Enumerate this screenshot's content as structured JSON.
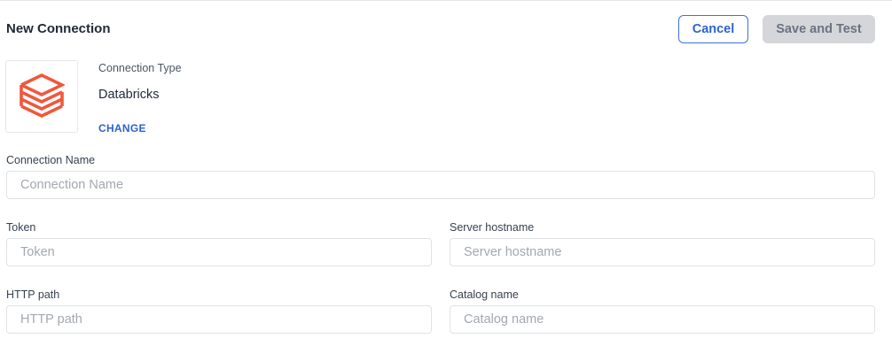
{
  "header": {
    "title": "New Connection",
    "cancel_label": "Cancel",
    "save_label": "Save and Test"
  },
  "connection_type": {
    "label": "Connection Type",
    "value": "Databricks",
    "change_label": "CHANGE",
    "icon": "databricks-logo",
    "icon_color": "#f0573d"
  },
  "fields": {
    "connection_name": {
      "label": "Connection Name",
      "placeholder": "Connection Name",
      "value": ""
    },
    "token": {
      "label": "Token",
      "placeholder": "Token",
      "value": ""
    },
    "server_hostname": {
      "label": "Server hostname",
      "placeholder": "Server hostname",
      "value": ""
    },
    "http_path": {
      "label": "HTTP path",
      "placeholder": "HTTP path",
      "value": ""
    },
    "catalog_name": {
      "label": "Catalog name",
      "placeholder": "Catalog name",
      "value": ""
    }
  },
  "colors": {
    "accent": "#2d63cc",
    "disabled_button": "#d4d6da"
  }
}
